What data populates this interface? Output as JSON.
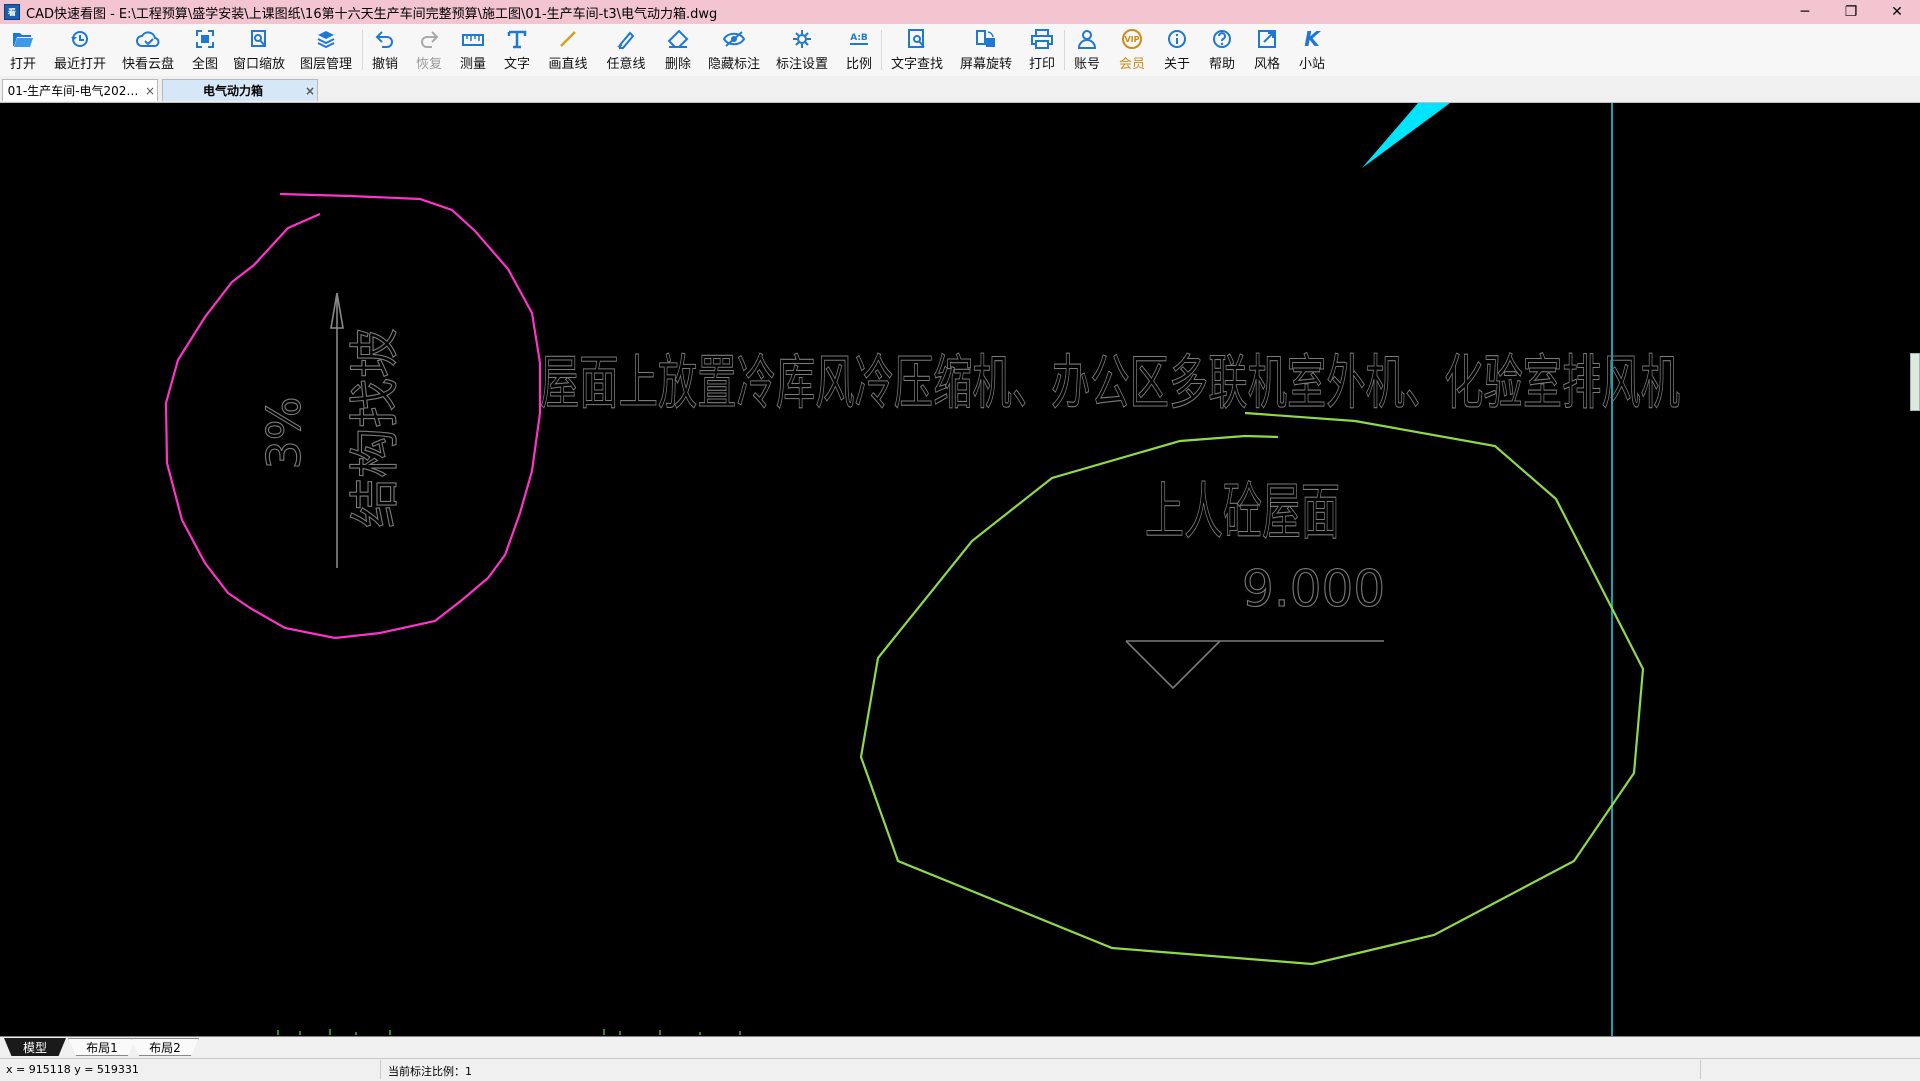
{
  "window": {
    "title": "CAD快速看图 - E:\\工程预算\\盛学安装\\上课图纸\\16第十六天生产车间完整预算\\施工图\\01-生产车间-t3\\电气动力箱.dwg",
    "minimize_glyph": "─",
    "restore_glyph": "❐",
    "close_glyph": "✕",
    "app_icon_text": "看"
  },
  "toolbar": {
    "items": [
      {
        "label": "打开",
        "icon": "folder-open-icon"
      },
      {
        "label": "最近打开",
        "icon": "recent-icon"
      },
      {
        "label": "快看云盘",
        "icon": "cloud-icon"
      },
      {
        "label": "全图",
        "icon": "zoom-extents-icon"
      },
      {
        "label": "窗口缩放",
        "icon": "zoom-window-icon"
      },
      {
        "label": "图层管理",
        "icon": "layers-icon"
      },
      {
        "label": "撤销",
        "icon": "undo-icon"
      },
      {
        "label": "恢复",
        "icon": "redo-icon"
      },
      {
        "label": "测量",
        "icon": "measure-icon"
      },
      {
        "label": "文字",
        "icon": "text-icon"
      },
      {
        "label": "画直线",
        "icon": "line-icon"
      },
      {
        "label": "任意线",
        "icon": "freehand-icon"
      },
      {
        "label": "删除",
        "icon": "eraser-icon"
      },
      {
        "label": "隐藏标注",
        "icon": "hide-annotation-icon"
      },
      {
        "label": "标注设置",
        "icon": "annotation-settings-icon"
      },
      {
        "label": "比例",
        "icon": "scale-icon"
      },
      {
        "label": "文字查找",
        "icon": "text-search-icon"
      },
      {
        "label": "屏幕旋转",
        "icon": "rotate-screen-icon"
      },
      {
        "label": "打印",
        "icon": "print-icon"
      },
      {
        "label": "账号",
        "icon": "account-icon"
      },
      {
        "label": "会员",
        "icon": "vip-icon"
      },
      {
        "label": "关于",
        "icon": "info-icon"
      },
      {
        "label": "帮助",
        "icon": "help-icon"
      },
      {
        "label": "风格",
        "icon": "style-icon"
      },
      {
        "label": "小站",
        "icon": "site-icon"
      }
    ],
    "vip_badge": "VIP",
    "scale_icon_text": "A:B",
    "site_icon_text": "K"
  },
  "tabs": [
    {
      "label": "01-生产车间-电气202…",
      "close": "×",
      "active": false
    },
    {
      "label": "电气动力箱",
      "close": "×",
      "active": true
    }
  ],
  "drawing": {
    "slope_percent": "3%",
    "slope_text": "结构找坡",
    "note_text": "屋面上放置冷库风冷压缩机、办公区多联机室外机、化验室排风机",
    "roof_text": "上人砼屋面",
    "elevation": "9.000",
    "colors": {
      "magenta_cloud": "#ff33cc",
      "green_cloud": "#8fd94a",
      "cyan": "#00e5ff",
      "text_gray": "#7a7a7a",
      "vertical_line": "#1aa0b0"
    }
  },
  "layout_tabs": [
    {
      "label": "模型",
      "active": true
    },
    {
      "label": "布局1",
      "active": false
    },
    {
      "label": "布局2",
      "active": false
    }
  ],
  "status": {
    "coords": "x = 915118  y = 519331",
    "scale_label": "当前标注比例：1"
  }
}
